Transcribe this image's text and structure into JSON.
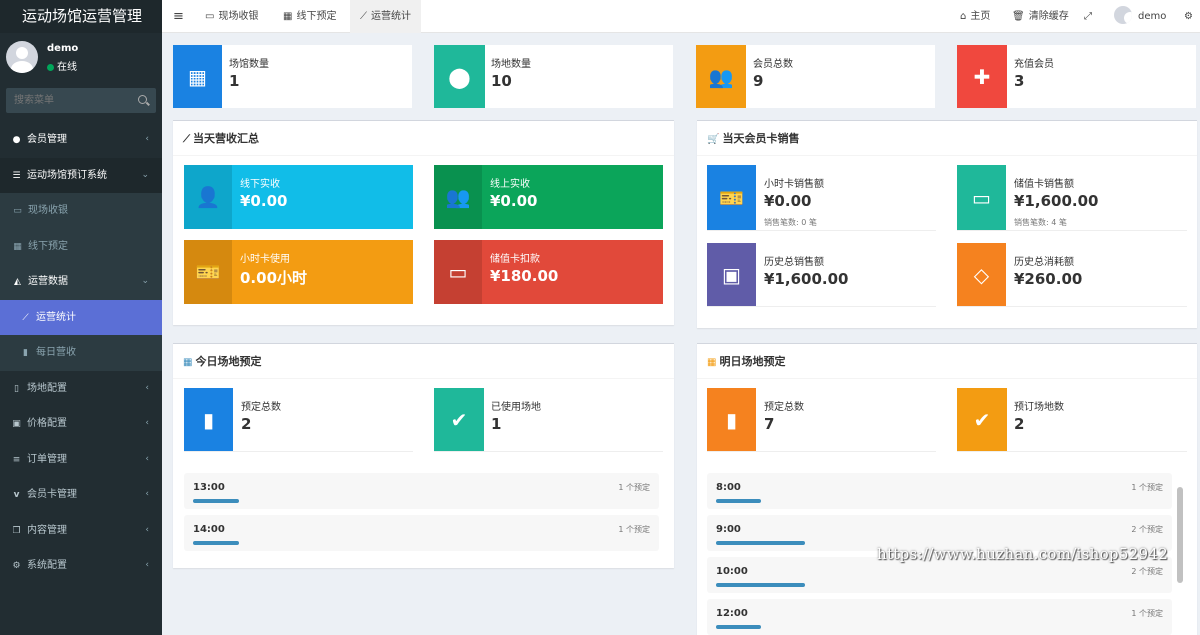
{
  "app": {
    "title": "运动场馆运营管理"
  },
  "user": {
    "name": "demo",
    "status": "在线"
  },
  "search": {
    "placeholder": "搜索菜单"
  },
  "menu": [
    {
      "label": "会员管理",
      "icon": "user-circle-icon"
    },
    {
      "label": "运动场馆预订系统",
      "icon": "list-icon"
    },
    {
      "label": "现场收银",
      "icon": "monitor-icon"
    },
    {
      "label": "线下预定",
      "icon": "calendar-icon"
    },
    {
      "label": "运营数据",
      "icon": "area-chart-icon"
    },
    {
      "label": "运营统计",
      "icon": "line-chart-icon"
    },
    {
      "label": "每日营收",
      "icon": "bar-chart-icon"
    },
    {
      "label": "场地配置",
      "icon": "building-icon"
    },
    {
      "label": "价格配置",
      "icon": "money-icon"
    },
    {
      "label": "订单管理",
      "icon": "list-lines-icon"
    },
    {
      "label": "会员卡管理",
      "icon": "vimeo-v-icon"
    },
    {
      "label": "内容管理",
      "icon": "copy-icon"
    },
    {
      "label": "系统配置",
      "icon": "cogs-icon"
    }
  ],
  "topbar": {
    "tabs": [
      {
        "label": "现场收银",
        "icon": "monitor-icon"
      },
      {
        "label": "线下预定",
        "icon": "calendar-icon"
      },
      {
        "label": "运营统计",
        "icon": "line-chart-icon"
      }
    ],
    "home": "主页",
    "clear_cache": "清除缓存",
    "user": "demo"
  },
  "stats": [
    {
      "label": "场馆数量",
      "value": "1",
      "color": "#1a82e2",
      "icon": "building-icon"
    },
    {
      "label": "场地数量",
      "value": "10",
      "color": "#1fb89a",
      "icon": "map-marker-icon"
    },
    {
      "label": "会员总数",
      "value": "9",
      "color": "#f39c12",
      "icon": "users-icon"
    },
    {
      "label": "充值会员",
      "value": "3",
      "color": "#f0483e",
      "icon": "user-plus-icon"
    }
  ],
  "revenue": {
    "title": "当天营收汇总",
    "items": [
      {
        "label": "线下实收",
        "value": "¥0.00",
        "color": "#11bde8",
        "icon": "user-icon"
      },
      {
        "label": "线上实收",
        "value": "¥0.00",
        "color": "#0ba55a",
        "icon": "users-icon"
      },
      {
        "label": "小时卡使用",
        "value": "0.00小时",
        "color": "#f39c12",
        "icon": "ticket-icon"
      },
      {
        "label": "储值卡扣款",
        "value": "¥180.00",
        "color": "#e1493a",
        "icon": "credit-card-icon"
      }
    ]
  },
  "cards": {
    "title": "当天会员卡销售",
    "items": [
      {
        "label": "小时卡销售额",
        "value": "¥0.00",
        "sub": "销售笔数: 0 笔",
        "color": "#1a82e2",
        "icon": "ticket-icon"
      },
      {
        "label": "储值卡销售额",
        "value": "¥1,600.00",
        "sub": "销售笔数: 4 笔",
        "color": "#1fb89a",
        "icon": "credit-card-icon"
      },
      {
        "label": "历史总销售额",
        "value": "¥1,600.00",
        "sub": "",
        "color": "#605ca8",
        "icon": "money-icon"
      },
      {
        "label": "历史总消耗额",
        "value": "¥260.00",
        "sub": "",
        "color": "#f5821f",
        "icon": "diamond-icon"
      }
    ]
  },
  "today": {
    "title": "今日场地预定",
    "stats": [
      {
        "label": "预定总数",
        "value": "2",
        "color": "#1a82e2",
        "icon": "bookmark-icon"
      },
      {
        "label": "已使用场地",
        "value": "1",
        "color": "#1fb89a",
        "icon": "check-circle-icon"
      }
    ],
    "slots": [
      {
        "time": "13:00",
        "count": "1 个预定",
        "level": 0.1
      },
      {
        "time": "14:00",
        "count": "1 个预定",
        "level": 0.1
      }
    ]
  },
  "tomorrow": {
    "title": "明日场地预定",
    "stats": [
      {
        "label": "预定总数",
        "value": "7",
        "color": "#f5821f",
        "icon": "bookmark-icon"
      },
      {
        "label": "预订场地数",
        "value": "2",
        "color": "#f39c12",
        "icon": "check-circle-icon"
      }
    ],
    "slots": [
      {
        "time": "8:00",
        "count": "1 个预定",
        "level": 0.1
      },
      {
        "time": "9:00",
        "count": "2 个预定",
        "level": 0.2
      },
      {
        "time": "10:00",
        "count": "2 个预定",
        "level": 0.2
      },
      {
        "time": "12:00",
        "count": "1 个预定",
        "level": 0.1
      }
    ]
  },
  "watermark": "https://www.huzhan.com/ishop52942"
}
